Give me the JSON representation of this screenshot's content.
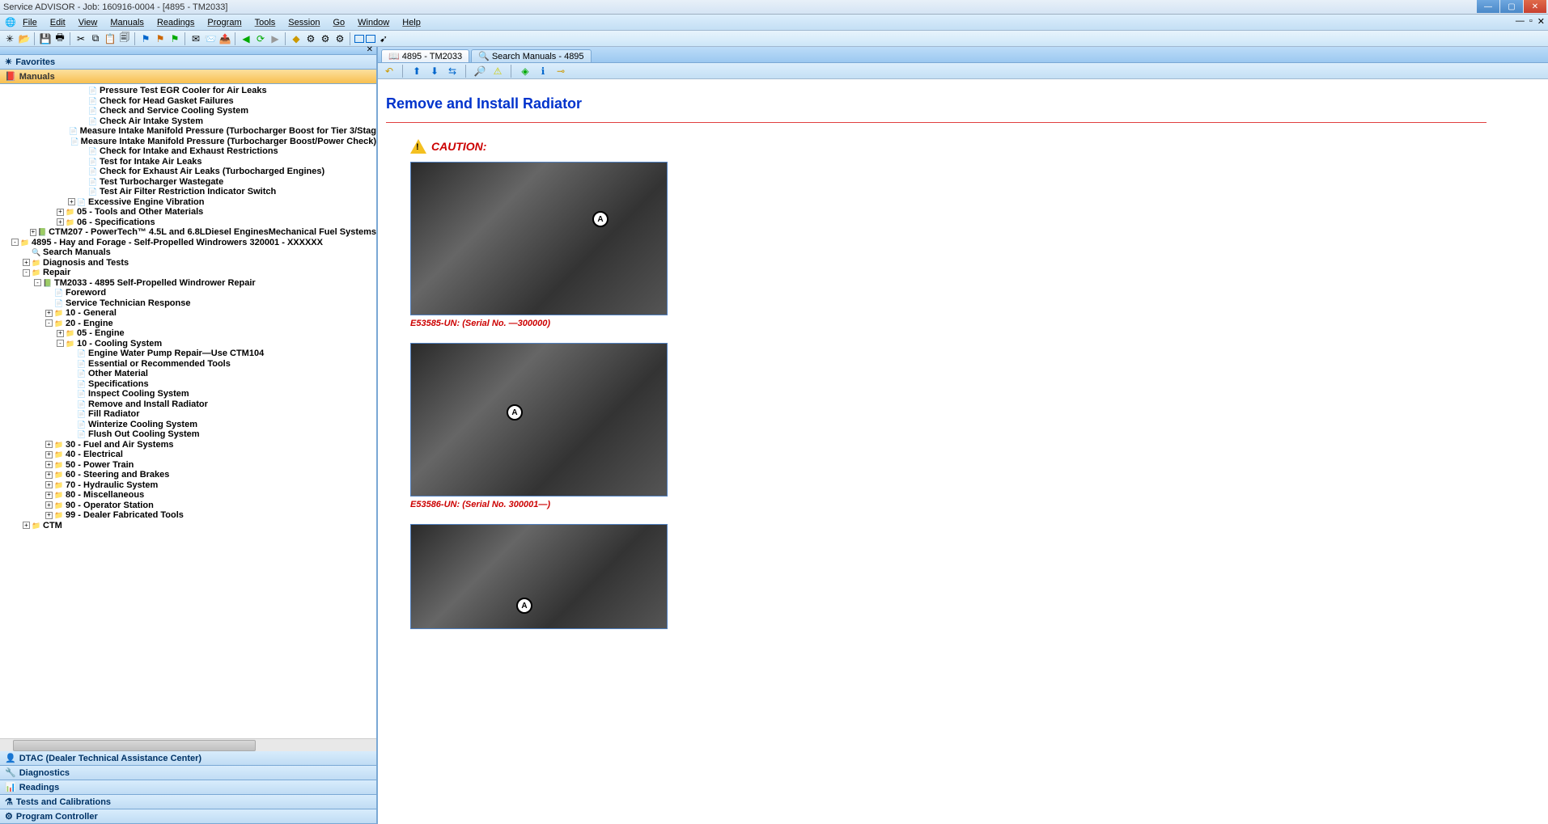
{
  "title": "Service ADVISOR - Job: 160916-0004 - [4895 - TM2033]",
  "menu": [
    "File",
    "Edit",
    "View",
    "Manuals",
    "Readings",
    "Program",
    "Tools",
    "Session",
    "Go",
    "Window",
    "Help"
  ],
  "accordion": {
    "favorites": "Favorites",
    "manuals": "Manuals",
    "dtac": "DTAC (Dealer Technical Assistance Center)",
    "diagnostics": "Diagnostics",
    "readings": "Readings",
    "tests": "Tests and Calibrations",
    "program": "Program Controller"
  },
  "tree": [
    {
      "d": 7,
      "i": "doc",
      "t": "Pressure Test EGR Cooler for Air Leaks"
    },
    {
      "d": 7,
      "i": "doc",
      "t": "Check for Head Gasket Failures"
    },
    {
      "d": 7,
      "i": "doc",
      "t": "Check and Service Cooling System"
    },
    {
      "d": 7,
      "i": "doc",
      "t": "Check Air Intake System"
    },
    {
      "d": 7,
      "i": "doc",
      "t": "Measure Intake Manifold Pressure (Turbocharger Boost for Tier 3/Stag"
    },
    {
      "d": 7,
      "i": "doc",
      "t": "Measure Intake Manifold Pressure (Turbocharger Boost/Power Check)"
    },
    {
      "d": 7,
      "i": "doc",
      "t": "Check for Intake and Exhaust Restrictions"
    },
    {
      "d": 7,
      "i": "doc",
      "t": "Test for Intake Air Leaks"
    },
    {
      "d": 7,
      "i": "doc",
      "t": "Check for Exhaust Air Leaks (Turbocharged Engines)"
    },
    {
      "d": 7,
      "i": "doc",
      "t": "Test Turbocharger Wastegate"
    },
    {
      "d": 7,
      "i": "doc",
      "t": "Test Air Filter Restriction Indicator Switch"
    },
    {
      "d": 6,
      "e": "+",
      "i": "doc",
      "t": "Excessive Engine Vibration"
    },
    {
      "d": 5,
      "e": "+",
      "i": "folder",
      "t": "05 - Tools and Other Materials"
    },
    {
      "d": 5,
      "e": "+",
      "i": "folder",
      "t": "06 - Specifications"
    },
    {
      "d": 3,
      "e": "+",
      "i": "book",
      "t": "CTM207 - PowerTech™ 4.5L and 6.8LDiesel EnginesMechanical Fuel Systems"
    },
    {
      "d": 1,
      "e": "-",
      "i": "folder",
      "t": "4895 - Hay and Forage - Self-Propelled Windrowers 320001 - XXXXXX"
    },
    {
      "d": 2,
      "i": "mag",
      "t": "Search Manuals"
    },
    {
      "d": 2,
      "e": "+",
      "i": "folder",
      "t": "Diagnosis and Tests"
    },
    {
      "d": 2,
      "e": "-",
      "i": "folder",
      "t": "Repair"
    },
    {
      "d": 3,
      "e": "-",
      "i": "book",
      "t": "TM2033 - 4895 Self-Propelled Windrower Repair"
    },
    {
      "d": 4,
      "i": "doc",
      "t": "Foreword"
    },
    {
      "d": 4,
      "i": "doc",
      "t": "Service Technician Response"
    },
    {
      "d": 4,
      "e": "+",
      "i": "folder",
      "t": "10 - General"
    },
    {
      "d": 4,
      "e": "-",
      "i": "folder",
      "t": "20 - Engine"
    },
    {
      "d": 5,
      "e": "+",
      "i": "folder",
      "t": "05 - Engine"
    },
    {
      "d": 5,
      "e": "-",
      "i": "folder",
      "t": "10 - Cooling System"
    },
    {
      "d": 6,
      "i": "doc",
      "t": "Engine Water Pump Repair—Use CTM104"
    },
    {
      "d": 6,
      "i": "doc",
      "t": "Essential or Recommended Tools"
    },
    {
      "d": 6,
      "i": "doc",
      "t": "Other Material"
    },
    {
      "d": 6,
      "i": "doc",
      "t": "Specifications"
    },
    {
      "d": 6,
      "i": "doc",
      "t": "Inspect Cooling System"
    },
    {
      "d": 6,
      "i": "doc",
      "t": "Remove and Install Radiator"
    },
    {
      "d": 6,
      "i": "doc",
      "t": "Fill Radiator"
    },
    {
      "d": 6,
      "i": "doc",
      "t": "Winterize Cooling System"
    },
    {
      "d": 6,
      "i": "doc",
      "t": "Flush Out Cooling System"
    },
    {
      "d": 4,
      "e": "+",
      "i": "folder",
      "t": "30 - Fuel and Air Systems"
    },
    {
      "d": 4,
      "e": "+",
      "i": "folder",
      "t": "40 - Electrical"
    },
    {
      "d": 4,
      "e": "+",
      "i": "folder",
      "t": "50 - Power Train"
    },
    {
      "d": 4,
      "e": "+",
      "i": "folder",
      "t": "60 - Steering and Brakes"
    },
    {
      "d": 4,
      "e": "+",
      "i": "folder",
      "t": "70 - Hydraulic System"
    },
    {
      "d": 4,
      "e": "+",
      "i": "folder",
      "t": "80 - Miscellaneous"
    },
    {
      "d": 4,
      "e": "+",
      "i": "folder",
      "t": "90 - Operator Station"
    },
    {
      "d": 4,
      "e": "+",
      "i": "folder",
      "t": "99 - Dealer Fabricated Tools"
    },
    {
      "d": 2,
      "e": "+",
      "i": "folder",
      "t": "CTM"
    }
  ],
  "tabs": [
    {
      "label": "4895 - TM2033",
      "icon": "book"
    },
    {
      "label": "Search Manuals - 4895",
      "icon": "mag"
    }
  ],
  "content": {
    "heading": "Remove and Install Radiator",
    "caution": "CAUTION:",
    "fig1_caption": "E53585-UN: (Serial No. —300000)",
    "fig2_caption": "E53586-UN: (Serial No. 300001—)"
  }
}
